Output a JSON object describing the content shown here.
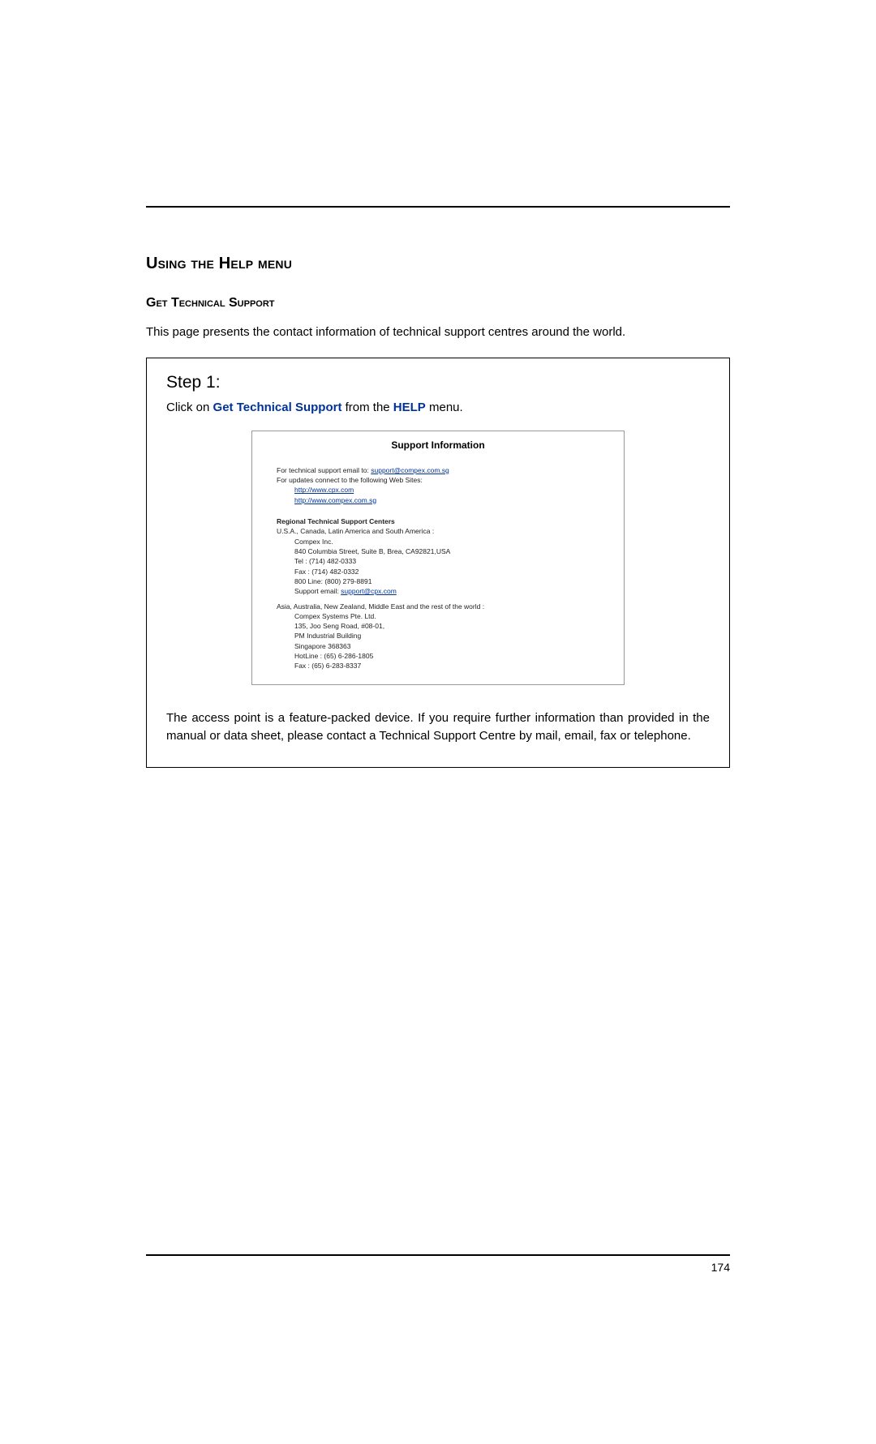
{
  "heading": "Using the Help menu",
  "subheading": "Get Technical Support",
  "intro": "This page presents the contact information of technical support centres around the world.",
  "step": {
    "title": "Step 1:",
    "instruction_pre": "Click on ",
    "instruction_link1": "Get Technical Support",
    "instruction_mid": " from the ",
    "instruction_link2": "HELP",
    "instruction_post": " menu.",
    "panel_title": "Support Information",
    "email_label": "For technical support email to: ",
    "email_link": "support@compex.com.sg",
    "updates_label": "For updates connect to the following Web Sites:",
    "site1": "http://www.cpx.com",
    "site2": "http://www.compex.com.sg",
    "centers_heading": "Regional Technical Support Centers",
    "region1_label": "U.S.A., Canada, Latin America and South America :",
    "r1_line1": "Compex Inc.",
    "r1_line2": "840 Columbia Street, Suite B, Brea, CA92821,USA",
    "r1_line3": "Tel : (714) 482-0333",
    "r1_line4": "Fax : (714) 482-0332",
    "r1_line5": "800 Line: (800) 279-8891",
    "r1_line6_pre": "Support email: ",
    "r1_line6_link": "support@cpx.com",
    "region2_label": "Asia, Australia, New Zealand, Middle East and the rest of the world :",
    "r2_line1": "Compex Systems Pte. Ltd.",
    "r2_line2": "135, Joo Seng Road, #08-01,",
    "r2_line3": "PM Industrial Building",
    "r2_line4": "Singapore 368363",
    "r2_line5": "HotLine : (65) 6-286-1805",
    "r2_line6": "Fax : (65) 6-283-8337",
    "closing": "The access point is a feature-packed device. If you require further information than provided in the manual or data sheet, please contact a Technical Support Centre by mail, email, fax or telephone."
  },
  "page_number": "174"
}
